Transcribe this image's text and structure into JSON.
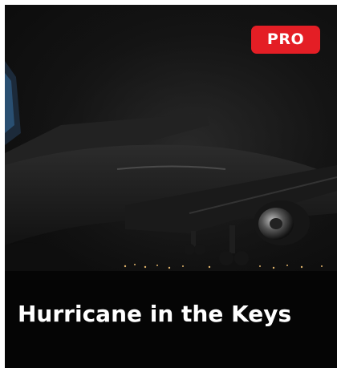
{
  "card": {
    "badge": "PRO",
    "title": "Hurricane in the Keys",
    "image": "airliner-landing-at-night"
  },
  "colors": {
    "badge_background": "#e41e25",
    "card_background": "#050505",
    "title_text": "#ffffff"
  }
}
